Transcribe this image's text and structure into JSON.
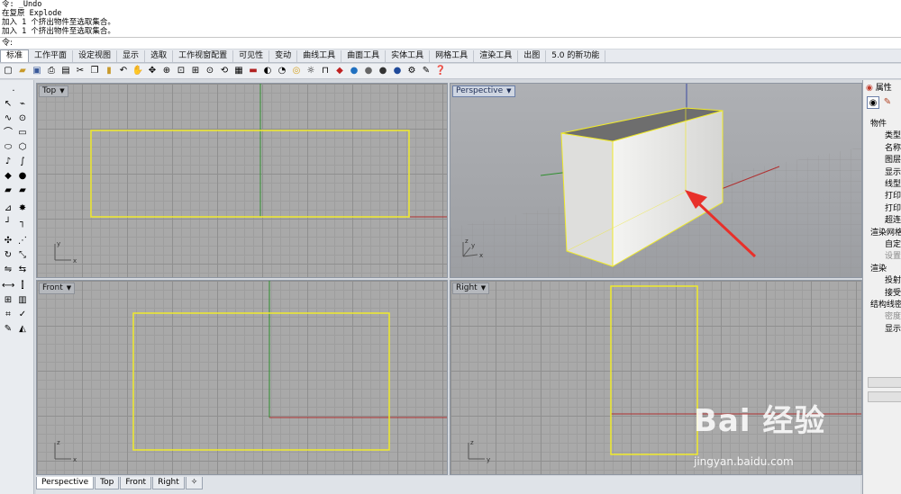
{
  "history": {
    "lines": [
      "令: _Undo",
      "在复原 Explode",
      "加入 1 个挤出物件至选取集合。",
      "加入 1 个挤出物件至选取集合。"
    ],
    "prompt": "令:"
  },
  "tabs": [
    "标准",
    "工作平面",
    "设定视图",
    "显示",
    "选取",
    "工作视窗配置",
    "可见性",
    "变动",
    "曲线工具",
    "曲面工具",
    "实体工具",
    "网格工具",
    "渲染工具",
    "出图",
    "5.0 的新功能"
  ],
  "viewports": {
    "top": {
      "title": "Top",
      "axis_x": "x",
      "axis_y": "y"
    },
    "perspective": {
      "title": "Perspective",
      "axis_x": "x",
      "axis_y": "y",
      "axis_z": "z"
    },
    "front": {
      "title": "Front",
      "axis_x": "x",
      "axis_z": "z"
    },
    "right": {
      "title": "Right",
      "axis_y": "y",
      "axis_z": "z"
    }
  },
  "view_tabs": [
    "Perspective",
    "Top",
    "Front",
    "Right",
    "✧"
  ],
  "properties": {
    "header": "属性",
    "rows": [
      {
        "type": "section",
        "text": "物件"
      },
      {
        "type": "item",
        "text": "类型"
      },
      {
        "type": "item",
        "text": "名称"
      },
      {
        "type": "item",
        "text": "图层"
      },
      {
        "type": "item",
        "text": "显示"
      },
      {
        "type": "item",
        "text": "线型"
      },
      {
        "type": "item",
        "text": "打印"
      },
      {
        "type": "item",
        "text": "打印"
      },
      {
        "type": "item",
        "text": "超连"
      },
      {
        "type": "section",
        "text": "渲染网格"
      },
      {
        "type": "item",
        "text": "自定"
      },
      {
        "type": "disabled",
        "text": "设置"
      },
      {
        "type": "section",
        "text": "渲染"
      },
      {
        "type": "item",
        "text": "投射"
      },
      {
        "type": "item",
        "text": "接受"
      },
      {
        "type": "section",
        "text": "结构线密"
      },
      {
        "type": "disabled",
        "text": "密度"
      },
      {
        "type": "item",
        "text": "显示"
      }
    ]
  },
  "watermark": {
    "main": "Bai 经验",
    "sub": "jingyan.baidu.com"
  },
  "colors": {
    "selection": "#f0ea2a",
    "x_axis": "#b03030",
    "y_axis": "#2f8f2f",
    "grid": "#a9a9a9",
    "annotation_arrow": "#e8302a"
  }
}
